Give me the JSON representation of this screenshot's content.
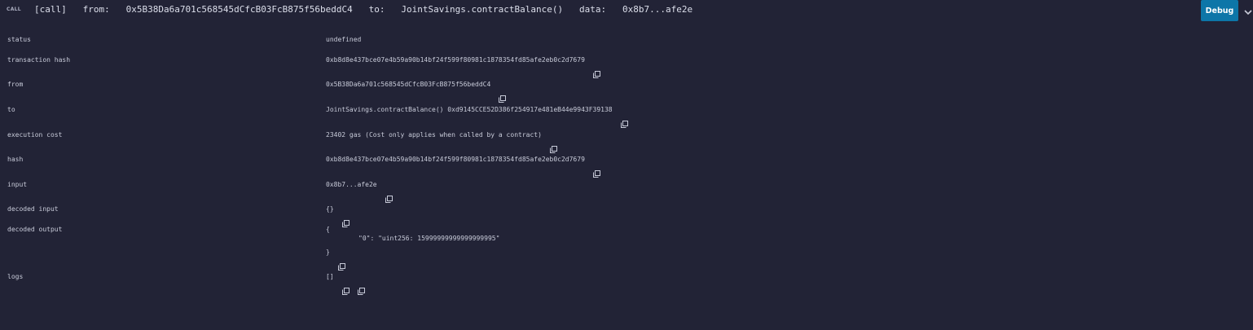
{
  "header": {
    "call_tag": "CALL",
    "bracket_call": "[call]",
    "from_label": "from:",
    "from_address": "0x5B38Da6a701c568545dCfcB03FcB875f56beddC4",
    "to_label": "to:",
    "to_target": "JointSavings.contractBalance()",
    "data_label": "data:",
    "data_value": "0x8b7...afe2e",
    "debug_label": "Debug"
  },
  "rows": {
    "status": {
      "label": "status",
      "value": "undefined"
    },
    "transaction_hash": {
      "label": "transaction hash",
      "value": "0xb8d8e437bce07e4b59a90b14bf24f599f80981c1878354fd85afe2eb0c2d7679"
    },
    "from": {
      "label": "from",
      "value": "0x5B38Da6a701c568545dCfcB03FcB875f56beddC4"
    },
    "to": {
      "label": "to",
      "value": "JointSavings.contractBalance() 0xd9145CCE52D386f254917e481eB44e9943F39138"
    },
    "execution_cost": {
      "label": "execution cost",
      "value": "23402 gas (Cost only applies when called by a contract)"
    },
    "hash": {
      "label": "hash",
      "value": "0xb8d8e437bce07e4b59a90b14bf24f599f80981c1878354fd85afe2eb0c2d7679"
    },
    "input": {
      "label": "input",
      "value": "0x8b7...afe2e"
    },
    "decoded_input": {
      "label": "decoded input",
      "value": "{}"
    },
    "decoded_output": {
      "label": "decoded output",
      "open_brace": "{",
      "entry": "\"0\": \"uint256: 15999999999999999995\"",
      "close_brace": "}"
    },
    "logs": {
      "label": "logs",
      "value": "[]"
    }
  },
  "colors": {
    "background": "#222336",
    "text": "#c8cbd9",
    "debug_button": "#0d76a8"
  },
  "icons": {
    "copy": "copy-icon",
    "chevron": "chevron-down-icon"
  }
}
